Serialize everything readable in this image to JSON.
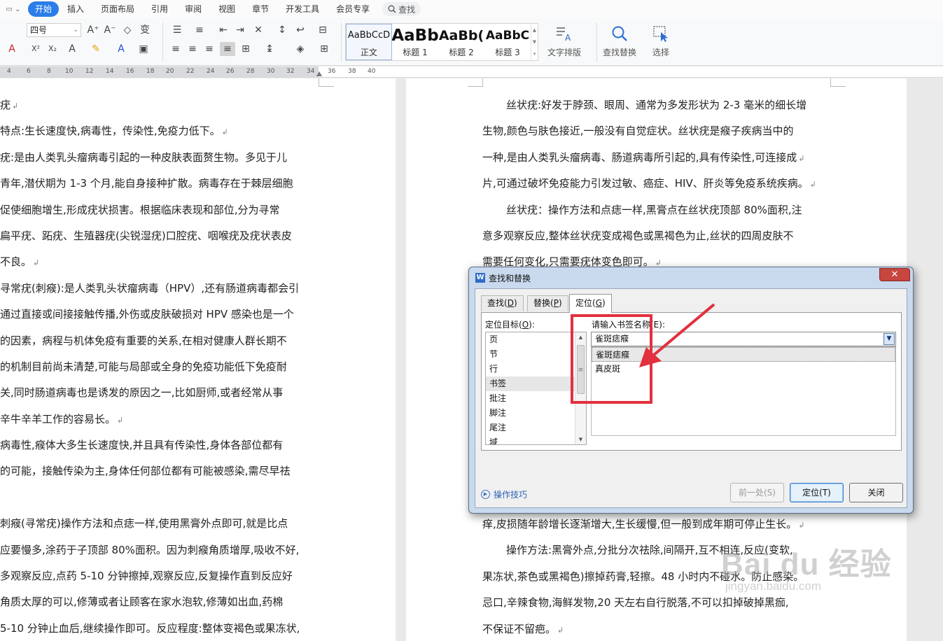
{
  "menu": {
    "tabs": [
      "开始",
      "插入",
      "页面布局",
      "引用",
      "审阅",
      "视图",
      "章节",
      "开发工具",
      "会员专享"
    ],
    "active": "开始",
    "search_label": "查找"
  },
  "ribbon": {
    "font_size": "四号",
    "styles": [
      {
        "preview": "AaBbCcD",
        "name": "正文"
      },
      {
        "preview": "AaBb",
        "name": "标题 1"
      },
      {
        "preview": "AaBb(",
        "name": "标题 2"
      },
      {
        "preview": "AaBbC",
        "name": "标题 3"
      }
    ],
    "text_layout_label": "文字排版",
    "find_replace_label": "查找替换",
    "select_label": "选择"
  },
  "ruler": {
    "ticks": [
      "4",
      "6",
      "8",
      "10",
      "12",
      "14",
      "16",
      "18",
      "20",
      "22",
      "24",
      "26",
      "28",
      "30",
      "32",
      "34",
      "36",
      "38",
      "40"
    ]
  },
  "left_page": {
    "lines": [
      "疣",
      "特点:生长速度快,病毒性，传染性,免疫力低下。",
      "疣:是由人类乳头瘤病毒引起的一种皮肤表面赘生物。多见于儿",
      "青年,潜伏期为 1-3 个月,能自身接种扩散。病毒存在于棘层细胞",
      "促使细胞增生,形成疣状损害。根据临床表现和部位,分为寻常",
      "扁平疣、跖疣、生殖器疣(尖锐湿疣)口腔疣、咽喉疣及疣状表皮",
      "不良。",
      "寻常疣(刺瘊):是人类乳头状瘤病毒（HPV）,还有肠道病毒都会引",
      "通过直接或间接接触传播,外伤或皮肤破损对 HPV 感染也是一个",
      "的因素，病程与机体免疫有重要的关系,在相对健康人群长期不",
      "的机制目前尚未清楚,可能与局部或全身的免疫功能低下免疫耐",
      "关,同时肠道病毒也是诱发的原因之一,比如厨师,或者经常从事",
      "辛牛辛羊工作的容易长。",
      "病毒性,瘊体大多生长速度快,并且具有传染性,身体各部位都有",
      "的可能，接触传染为主,身体任何部位都有可能被感染,需尽早祛",
      "",
      "刺瘊(寻常疣)操作方法和点痣一样,使用黑膏外点即可,就是比点",
      "应要慢多,涂药于子顶部 80%面积。因为刺瘊角质增厚,吸收不好,",
      "多观察反应,点药 5-10 分钟擦掉,观察反应,反复操作直到反应好",
      "角质太厚的可以,修薄或者让顾客在家水泡软,修薄如出血,药棉",
      "5-10 分钟止血后,继续操作即可。反应程度:整体变褐色或果冻状,"
    ]
  },
  "right_page": {
    "lines": [
      "丝状疣:好发于脖颈、眼周、通常为多发形状为 2-3 毫米的细长增",
      "生物,颜色与肤色接近,一般没有自觉症状。丝状疣是瘊子疾病当中的",
      "一种,是由人类乳头瘤病毒、肠道病毒所引起的,具有传染性,可连接成",
      "片,可通过破坏免疫能力引发过敏、癌症、HIV、肝炎等免疫系统疾病。",
      "丝状疣：操作方法和点痣一样,黑膏点在丝状疣顶部 80%面积,注",
      "意多观察反应,整体丝状疣变成褐色或黑褐色为止,丝状的四周皮肤不",
      "需要任何变化,只需要疣体变色即可。"
    ],
    "lines_bottom": [
      "痒,皮损随年龄增长逐渐增大,生长缓慢,但一般到成年期可停止生长。",
      "操作方法:黑膏外点,分批分次祛除,间隔开,互不相连,反应(变软,",
      "果冻状,茶色或黑褐色)擦掉药膏,轻擦。48 小时内不碰水。防止感染。",
      "忌口,辛辣食物,海鲜发物,20 天左右自行脱落,不可以扣掉破掉黑痂,",
      "不保证不留疤。"
    ]
  },
  "watermark": {
    "line1": "Bai du 经验",
    "line2": "jingyan.baidu.com"
  },
  "dialog": {
    "title": "查找和替换",
    "close_glyph": "✕",
    "tabs": [
      {
        "label": "查找(",
        "key": "D",
        "tail": ")"
      },
      {
        "label": "替换(",
        "key": "P",
        "tail": ")"
      },
      {
        "label": "定位(",
        "key": "G",
        "tail": ")"
      }
    ],
    "target_label": "定位目标(",
    "target_key": "O",
    "target_tail": "):",
    "targets": [
      "页",
      "节",
      "行",
      "书签",
      "批注",
      "脚注",
      "尾注",
      "域"
    ],
    "selected_target": "书签",
    "bookmark_label": "请输入书签名称(E):",
    "bookmark_value": "雀斑痣瘊",
    "bookmarks": [
      "雀斑痣瘊",
      "真皮斑"
    ],
    "selected_bookmark": "雀斑痣瘊",
    "tips_label": "操作技巧",
    "buttons": {
      "prev": "前一处(S)",
      "goto": "定位(T)",
      "close": "关闭"
    }
  },
  "colors": {
    "accent": "#2b7de9",
    "annotation_red": "#e2303e",
    "dialog_frame": "#c9d9ee"
  }
}
